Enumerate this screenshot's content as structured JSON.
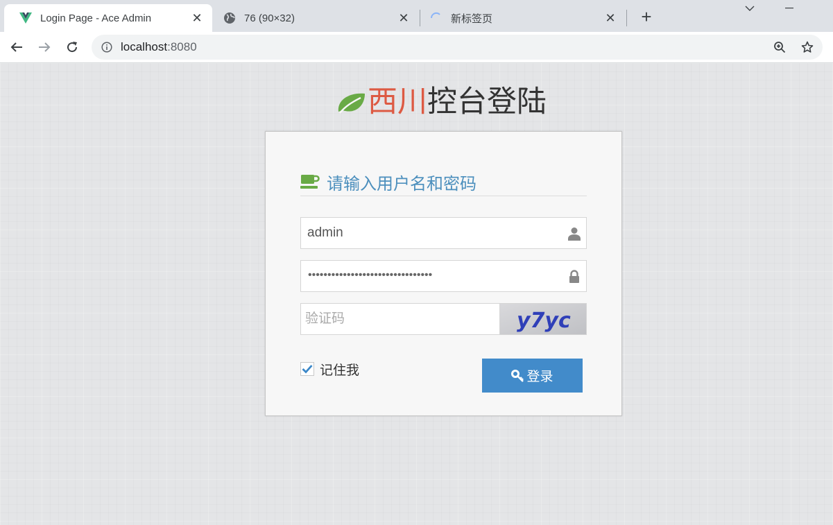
{
  "browser": {
    "tabs": [
      {
        "title": "Login Page - Ace Admin",
        "favicon": "vue-logo-icon",
        "active": true
      },
      {
        "title": "76 (90×32)",
        "favicon": "globe-icon",
        "active": false
      },
      {
        "title": "新标签页",
        "favicon": "loading-spinner-icon",
        "active": false
      }
    ],
    "new_tab_label": "+",
    "address": {
      "host": "localhost",
      "port": ":8080"
    }
  },
  "brand": {
    "part1": "西川",
    "part2": "控台登陆",
    "accent": "#dd5a43",
    "leaf_color": "#69aa46"
  },
  "login": {
    "header": "请输入用户名和密码",
    "username": {
      "value": "admin",
      "icon": "user-icon"
    },
    "password": {
      "masked": "••••••••••••••••••••••••••••••••",
      "icon": "lock-icon"
    },
    "captcha": {
      "placeholder": "验证码",
      "image_text": "y7yc"
    },
    "remember": {
      "label": "记住我",
      "checked": true
    },
    "submit_label": "登录",
    "header_color": "#4c8fbd",
    "button_color": "#428bca"
  }
}
